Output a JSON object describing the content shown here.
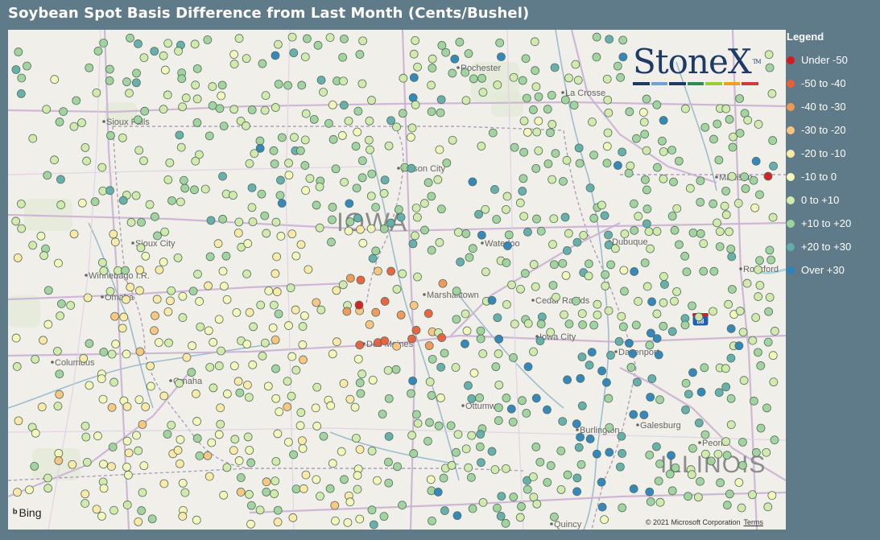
{
  "title": "Soybean Spot Basis Difference from Last Month (Cents/Bushel)",
  "legend": {
    "title": "Legend",
    "items": [
      {
        "label": "Under -50",
        "color": "#d7191c"
      },
      {
        "label": "-50 to -40",
        "color": "#ec5d3a"
      },
      {
        "label": "-40 to -30",
        "color": "#f49653"
      },
      {
        "label": "-30 to -20",
        "color": "#fbc47d"
      },
      {
        "label": "-20 to -10",
        "color": "#fde9a4"
      },
      {
        "label": "-10 to 0",
        "color": "#f5f8b7"
      },
      {
        "label": "0 to +10",
        "color": "#d1ebaa"
      },
      {
        "label": "+10 to +20",
        "color": "#9fd39c"
      },
      {
        "label": "+20 to +30",
        "color": "#61ada9"
      },
      {
        "label": "Over +30",
        "color": "#2b83ba"
      }
    ]
  },
  "logo": {
    "text": "StoneX",
    "tm": "TM",
    "stripe_colors": [
      "#1e3a66",
      "#6fa3d4",
      "#1e3a66",
      "#2e8b57",
      "#9acd32",
      "#f0a020",
      "#d33b3b"
    ]
  },
  "map_labels": {
    "state_iowa": "IOWA",
    "state_illinois": "ILLINOIS",
    "cities": [
      "Rochester",
      "La Crosse",
      "Sioux Falls",
      "Mason City",
      "Madison",
      "Sioux City",
      "Waterloo",
      "Dubuque",
      "Winnebago I.R.",
      "Omaha",
      "Marshalltown",
      "Cedar Rapids",
      "Rockford",
      "Des Moines",
      "Iowa City",
      "Davenport",
      "Columbus",
      "Omaha",
      "Ottumwa",
      "Galesburg",
      "Burlington",
      "Peoria",
      "Quincy"
    ],
    "highway_shield": "88"
  },
  "attribution": {
    "bing": "Bing",
    "copyright": "© 2021 Microsoft Corporation",
    "terms": "Terms"
  }
}
